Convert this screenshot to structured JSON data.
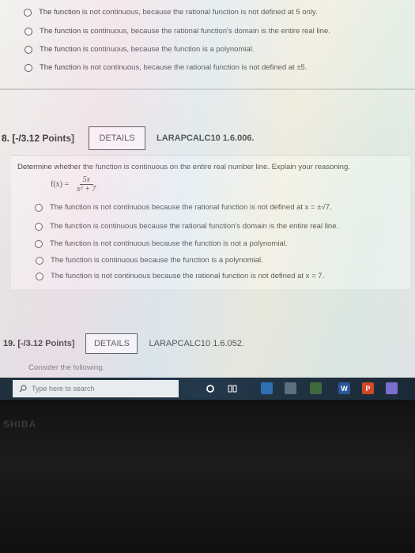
{
  "prev_question": {
    "options": [
      "The function is not continuous, because the rational function is not defined at 5 only.",
      "The function is continuous, because the rational function's domain is the entire real line.",
      "The function is continuous, because the function is a polynomial.",
      "The function is not continuous, because the rational function is not defined at ±5."
    ]
  },
  "question18": {
    "number_points": "8. [-/3.12 Points]",
    "details_label": "DETAILS",
    "code": "LARAPCALC10 1.6.006.",
    "prompt": "Determine whether the function is continuous on the entire real number line. Explain your reasoning.",
    "formula": {
      "lhs": "f(x) =",
      "numerator": "5x",
      "denominator": "x² + 7"
    },
    "options": [
      "The function is not continuous because the rational function is not defined at x = ±√7.",
      "The function is continuous because the rational function's domain is the entire real line.",
      "The function is not continuous because the function is not a polynomial.",
      "The function is continuous because the function is a polynomial.",
      "The function is not continuous because the rational function is not defined at x = 7."
    ]
  },
  "question19": {
    "number_points": "19. [-/3.12 Points]",
    "details_label": "DETAILS",
    "code": "LARAPCALC10 1.6.052.",
    "prompt": "Consider the following."
  },
  "taskbar": {
    "search_placeholder": "Type here to search",
    "icons": [
      "cortana-circle-icon",
      "task-view-icon",
      "browser-icon",
      "store-icon",
      "word-icon",
      "powerpoint-icon",
      "app-icon"
    ]
  },
  "bezel": {
    "brand": "SHIBA"
  },
  "colors": {
    "taskbar": "#23384a",
    "word": "#2b579a",
    "powerpoint": "#d24726"
  }
}
